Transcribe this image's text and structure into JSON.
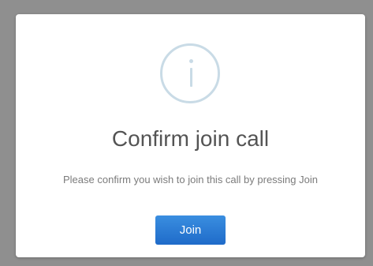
{
  "dialog": {
    "icon": "info-icon",
    "title": "Confirm join call",
    "message": "Please confirm you wish to join this call by pressing Join",
    "join_label": "Join"
  },
  "colors": {
    "overlay": "#8f8f8f",
    "icon": "#c9dbe6",
    "button": "#2a7bd6",
    "title": "#545454",
    "message": "#7b7b7b"
  }
}
